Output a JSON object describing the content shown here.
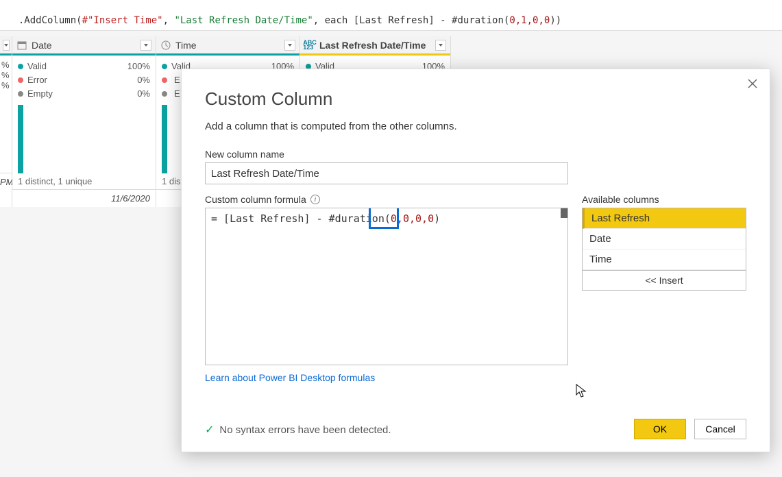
{
  "formula_bar": {
    "prefix": ".AddColumn(",
    "arg1": "#\"Insert Time\"",
    "arg2": "\"Last Refresh Date/Time\"",
    "each": ", each [Last Refresh] - #duration(",
    "nums": "0,1,0,0",
    "suffix": "))"
  },
  "columns": [
    {
      "type": "date",
      "label": "Date",
      "stats": {
        "valid": "100%",
        "error": "0%",
        "empty": "0%"
      },
      "distinct": "1 distinct, 1 unique",
      "row": "11/6/2020",
      "selected": false,
      "left_prefix": "%\n%\n%",
      "left_time": "PM"
    },
    {
      "type": "time",
      "label": "Time",
      "stats_partial": {
        "valid_label": "Valid",
        "valid_pct": "100%",
        "e1": "E",
        "e2": "E"
      },
      "distinct": "1 dis",
      "selected": false
    },
    {
      "type": "any",
      "label": "Last Refresh Date/Time",
      "stats_partial": {
        "valid_label": "Valid",
        "valid_pct": "100%"
      },
      "selected": true
    }
  ],
  "dialog": {
    "title": "Custom Column",
    "subtitle": "Add a column that is computed from the other columns.",
    "name_label": "New column name",
    "name_value": "Last Refresh Date/Time",
    "formula_label": "Custom column formula",
    "formula_prefix": "= [Last Refresh] - #duration(",
    "formula_nums": "0,0,0,0",
    "formula_suffix": ")",
    "avail_label": "Available columns",
    "avail": [
      {
        "label": "Last Refresh",
        "selected": true
      },
      {
        "label": "Date",
        "selected": false
      },
      {
        "label": "Time",
        "selected": false
      }
    ],
    "insert_label": "<< Insert",
    "link": "Learn about Power BI Desktop formulas",
    "status": "No syntax errors have been detected.",
    "ok": "OK",
    "cancel": "Cancel"
  },
  "labels": {
    "valid": "Valid",
    "error": "Error",
    "empty": "Empty"
  }
}
